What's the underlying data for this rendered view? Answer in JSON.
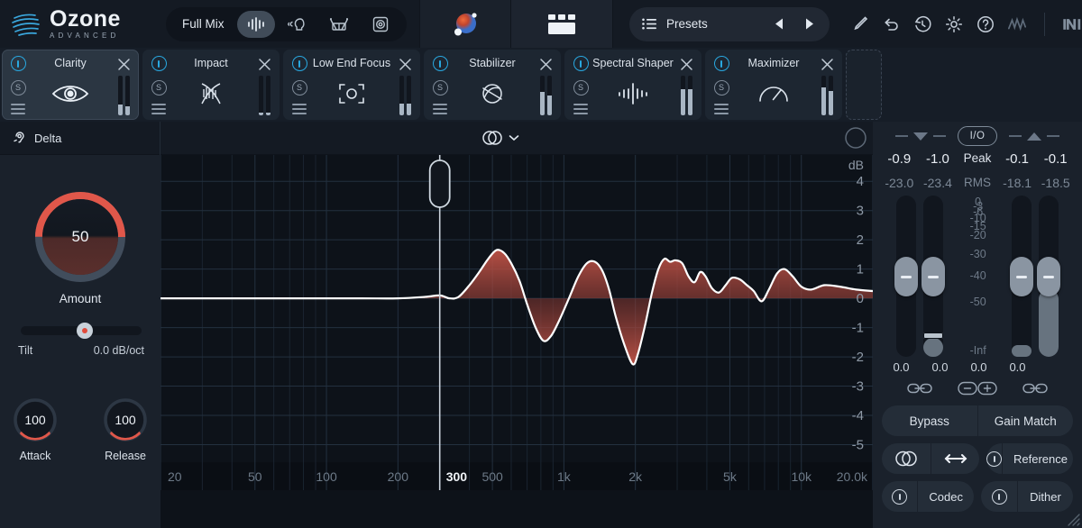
{
  "app": {
    "brand_name": "Ozone",
    "brand_sub": "ADVANCED"
  },
  "toolbar": {
    "mix_label": "Full Mix",
    "mix_modes": [
      {
        "name": "full-mix",
        "icon": "waveform-icon",
        "active": true
      },
      {
        "name": "vocal",
        "icon": "vocal-head-icon",
        "active": false
      },
      {
        "name": "drums",
        "icon": "drum-icon",
        "active": false
      },
      {
        "name": "bass",
        "icon": "speaker-icon",
        "active": false
      }
    ],
    "assistant_icon": "master-assistant-orb-icon",
    "view_icon": "module-grid-icon",
    "presets_label": "Presets",
    "presets_menu_icon": "list-icon",
    "prev_icon": "triangle-left-icon",
    "next_icon": "triangle-right-icon",
    "tools": [
      {
        "name": "pencil-icon"
      },
      {
        "name": "undo-icon"
      },
      {
        "name": "history-icon"
      },
      {
        "name": "gear-icon"
      },
      {
        "name": "help-icon"
      },
      {
        "name": "waveform-squiggle-icon"
      },
      {
        "name": "native-instruments-logo-icon"
      }
    ]
  },
  "modules": [
    {
      "name": "Clarity",
      "glyph": "eye-icon",
      "selected": true,
      "enabled": true,
      "meters": [
        0.28,
        0.22
      ]
    },
    {
      "name": "Impact",
      "glyph": "impact-icon",
      "selected": false,
      "enabled": true,
      "meters": [
        0.06,
        0.06
      ]
    },
    {
      "name": "Low End Focus",
      "glyph": "focus-frame-icon",
      "selected": false,
      "enabled": true,
      "meters": [
        0.3,
        0.3
      ]
    },
    {
      "name": "Stabilizer",
      "glyph": "stabilizer-icon",
      "selected": false,
      "enabled": true,
      "meters": [
        0.58,
        0.5
      ]
    },
    {
      "name": "Spectral Shaper",
      "glyph": "spectral-bars-icon",
      "selected": false,
      "enabled": true,
      "meters": [
        0.66,
        0.66
      ]
    },
    {
      "name": "Maximizer",
      "glyph": "gauge-icon",
      "selected": false,
      "enabled": true,
      "meters": [
        0.7,
        0.62
      ]
    }
  ],
  "add_module_slot": {
    "name": "add-module-slot"
  },
  "delta_bar": {
    "delta_label": "Delta",
    "delta_icon": "ear-icon",
    "stereo_icon": "stereo-link-icon",
    "chevron_icon": "chevron-down-icon"
  },
  "controls": {
    "amount_value": "50",
    "amount_label": "Amount",
    "tilt_label": "Tilt",
    "tilt_value": "0.0 dB/oct",
    "attack_value": "100",
    "attack_label": "Attack",
    "release_value": "100",
    "release_label": "Release"
  },
  "meters": {
    "io_label": "I/O",
    "peak_label": "Peak",
    "rms_label": "RMS",
    "input": {
      "peak": [
        "-0.9",
        "-1.0"
      ],
      "rms": [
        "-23.0",
        "-23.4"
      ],
      "gain": [
        "0.0",
        "0.0"
      ]
    },
    "output": {
      "peak": [
        "-0.1",
        "-0.1"
      ],
      "rms": [
        "-18.1",
        "-18.5"
      ],
      "gain": [
        "0.0",
        "0.0"
      ]
    },
    "scale": [
      "0",
      "-3",
      "-6",
      "-10",
      "-15",
      "-20",
      "-30",
      "-40",
      "-50",
      "-Inf"
    ],
    "link_icon": "link-icon",
    "minus_icon": "minus-icon",
    "plus_icon": "plus-icon"
  },
  "bottom_buttons": {
    "bypass": "Bypass",
    "gain_match": "Gain Match",
    "stereo_icon": "stereo-link-icon",
    "width_icon": "width-arrows-icon",
    "reference": "Reference",
    "codec": "Codec",
    "dither": "Dither"
  },
  "chart_data": {
    "type": "line",
    "title": "",
    "xlabel": "",
    "ylabel": "dB",
    "y_axis_unit": "dB",
    "xtick_labels": [
      "20",
      "50",
      "100",
      "200",
      "300",
      "500",
      "1k",
      "2k",
      "5k",
      "10k",
      "20.0k"
    ],
    "xtick_highlight": "300",
    "ytick_labels": [
      "4",
      "3",
      "2",
      "1",
      "0",
      "-1",
      "-2",
      "-3",
      "-4",
      "-5"
    ],
    "ylim": [
      -5.6,
      4.9
    ],
    "xlim_hz": [
      20,
      20000
    ],
    "grid": true,
    "crossover_hz": 300,
    "curve_color": "#ffffff",
    "fill_color": "#b34a3e",
    "series": [
      {
        "name": "Clarity EQ Curve",
        "points_hz_db": [
          [
            20,
            0.0
          ],
          [
            40,
            0.0
          ],
          [
            80,
            0.0
          ],
          [
            140,
            0.0
          ],
          [
            200,
            0.0
          ],
          [
            260,
            0.05
          ],
          [
            300,
            0.1
          ],
          [
            330,
            0.0
          ],
          [
            360,
            0.05
          ],
          [
            400,
            0.45
          ],
          [
            440,
            0.9
          ],
          [
            480,
            1.35
          ],
          [
            520,
            1.65
          ],
          [
            560,
            1.55
          ],
          [
            600,
            1.2
          ],
          [
            650,
            0.6
          ],
          [
            700,
            -0.2
          ],
          [
            760,
            -1.0
          ],
          [
            820,
            -1.45
          ],
          [
            880,
            -1.3
          ],
          [
            950,
            -0.8
          ],
          [
            1050,
            0.0
          ],
          [
            1150,
            0.75
          ],
          [
            1250,
            1.2
          ],
          [
            1350,
            1.25
          ],
          [
            1450,
            0.95
          ],
          [
            1550,
            0.3
          ],
          [
            1650,
            -0.6
          ],
          [
            1800,
            -1.6
          ],
          [
            1950,
            -2.25
          ],
          [
            2050,
            -1.9
          ],
          [
            2200,
            -0.9
          ],
          [
            2350,
            0.2
          ],
          [
            2500,
            1.0
          ],
          [
            2650,
            1.35
          ],
          [
            2800,
            1.25
          ],
          [
            2950,
            1.3
          ],
          [
            3150,
            1.2
          ],
          [
            3350,
            0.75
          ],
          [
            3550,
            0.55
          ],
          [
            3750,
            0.9
          ],
          [
            3950,
            0.75
          ],
          [
            4200,
            0.35
          ],
          [
            4500,
            0.2
          ],
          [
            4800,
            0.45
          ],
          [
            5100,
            0.7
          ],
          [
            5500,
            0.65
          ],
          [
            5900,
            0.45
          ],
          [
            6300,
            0.25
          ],
          [
            6800,
            -0.1
          ],
          [
            7300,
            0.3
          ],
          [
            7900,
            0.85
          ],
          [
            8500,
            1.0
          ],
          [
            9200,
            0.75
          ],
          [
            10000,
            0.4
          ],
          [
            11000,
            0.3
          ],
          [
            12500,
            0.45
          ],
          [
            14500,
            0.4
          ],
          [
            17000,
            0.3
          ],
          [
            20000,
            0.25
          ]
        ]
      }
    ]
  }
}
